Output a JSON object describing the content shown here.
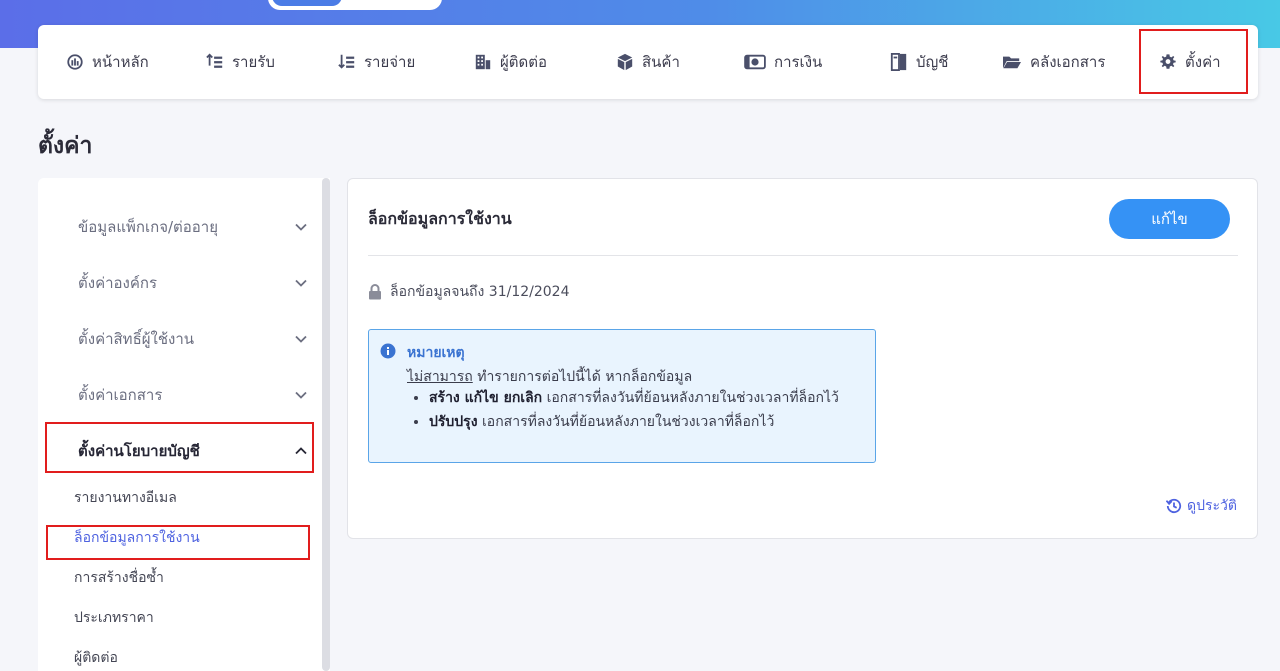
{
  "nav": {
    "items": [
      {
        "label": "หน้าหลัก",
        "icon": "dashboard-icon"
      },
      {
        "label": "รายรับ",
        "icon": "income-icon"
      },
      {
        "label": "รายจ่าย",
        "icon": "expense-icon"
      },
      {
        "label": "ผู้ติดต่อ",
        "icon": "contacts-icon"
      },
      {
        "label": "สินค้า",
        "icon": "box-icon"
      },
      {
        "label": "การเงิน",
        "icon": "money-icon"
      },
      {
        "label": "บัญชี",
        "icon": "ledger-icon"
      },
      {
        "label": "คลังเอกสาร",
        "icon": "folder-icon"
      },
      {
        "label": "ตั้งค่า",
        "icon": "gear-icon"
      }
    ]
  },
  "page": {
    "title": "ตั้งค่า"
  },
  "sidebar": {
    "sections": [
      {
        "label": "ข้อมูลแพ็กเกจ/ต่ออายุ"
      },
      {
        "label": "ตั้งค่าองค์กร"
      },
      {
        "label": "ตั้งค่าสิทธิ์ผู้ใช้งาน"
      },
      {
        "label": "ตั้งค่าเอกสาร"
      },
      {
        "label": "ตั้งค่านโยบายบัญชี"
      }
    ],
    "sub_items": [
      {
        "label": "รายงานทางอีเมล"
      },
      {
        "label": "ล็อกข้อมูลการใช้งาน"
      },
      {
        "label": "การสร้างชื่อซ้ำ"
      },
      {
        "label": "ประเภทราคา"
      },
      {
        "label": "ผู้ติดต่อ"
      }
    ]
  },
  "panel": {
    "title": "ล็อกข้อมูลการใช้งาน",
    "edit_label": "แก้ไข",
    "lock_text": "ล็อกข้อมูลจนถึง 31/12/2024",
    "note": {
      "title": "หมายเหตุ",
      "line_underlined": "ไม่สามารถ",
      "line_rest": " ทำรายการต่อไปนี้ได้ หากล็อกข้อมูล",
      "bullets": [
        {
          "bold": "สร้าง แก้ไข ยกเลิก",
          "text": " เอกสารที่ลงวันที่ย้อนหลังภายในช่วงเวลาที่ล็อกไว้"
        },
        {
          "bold": "ปรับปรุง",
          "text": " เอกสารที่ลงวันที่ย้อนหลังภายในช่วงเวลาที่ล็อกไว้"
        }
      ]
    },
    "history_label": "ดูประวัติ"
  },
  "colors": {
    "accent": "#3592f5",
    "highlight": "#e11d1d",
    "active_link": "#4e62e0",
    "note_bg": "#e9f4fe"
  }
}
